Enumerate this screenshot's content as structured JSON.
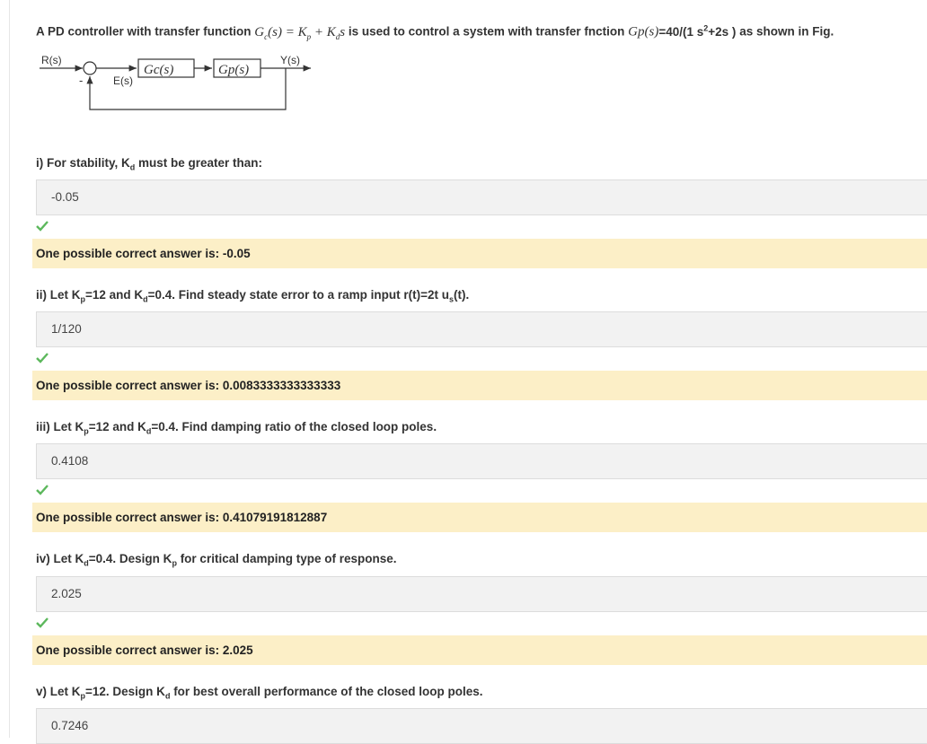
{
  "intro": {
    "prefix": "A PD controller with transfer function",
    "gc_formula": "Gc(s) = Kp + Kds",
    "middle": "is used to control a system with transfer fnction",
    "gp_label": "Gp(s)",
    "gp_value": "=40/(1 s²+2s )",
    "suffix": "as shown in Fig."
  },
  "diagram": {
    "input": "R(s)",
    "error": "E(s)",
    "output": "Y(s)",
    "controller": "Gc(s)",
    "plant": "Gp(s)",
    "minus": "-"
  },
  "questions": [
    {
      "label_pre": "i)  For stability, K",
      "label_sub": "d",
      "label_post": " must be greater than:",
      "answer": "-0.05",
      "status": "correct",
      "feedback": "One possible correct answer is: -0.05"
    },
    {
      "label_pre": "ii) Let K",
      "label_sub": "p",
      "label_post": "=12 and K",
      "label_sub2": "d",
      "label_post2": "=0.4. Find steady state error to a ramp input r(t)=2t u",
      "label_sub3": "s",
      "label_post3": "(t).",
      "answer": "1/120",
      "status": "correct",
      "feedback": "One possible correct answer is: 0.0083333333333333"
    },
    {
      "label_pre": "iii) Let K",
      "label_sub": "p",
      "label_post": "=12 and K",
      "label_sub2": "d",
      "label_post2": "=0.4. Find damping ratio of the closed loop poles.",
      "answer": "0.4108",
      "status": "correct",
      "feedback": "One possible correct answer is: 0.41079191812887"
    },
    {
      "label_pre": "iv) Let K",
      "label_sub": "d",
      "label_post": "=0.4. Design K",
      "label_sub2": "p",
      "label_post2": " for critical damping type of response.",
      "answer": "2.025",
      "status": "correct",
      "feedback": "One possible correct answer is: 2.025"
    },
    {
      "label_pre": "v) Let K",
      "label_sub": "p",
      "label_post": "=12. Design K",
      "label_sub2": "d",
      "label_post2": " for best overall performance of the closed loop poles.",
      "answer": "0.7246"
    }
  ],
  "colors": {
    "check": "#5cb85c",
    "feedback_bg": "#fcefc7",
    "answer_bg": "#f2f2f2"
  }
}
